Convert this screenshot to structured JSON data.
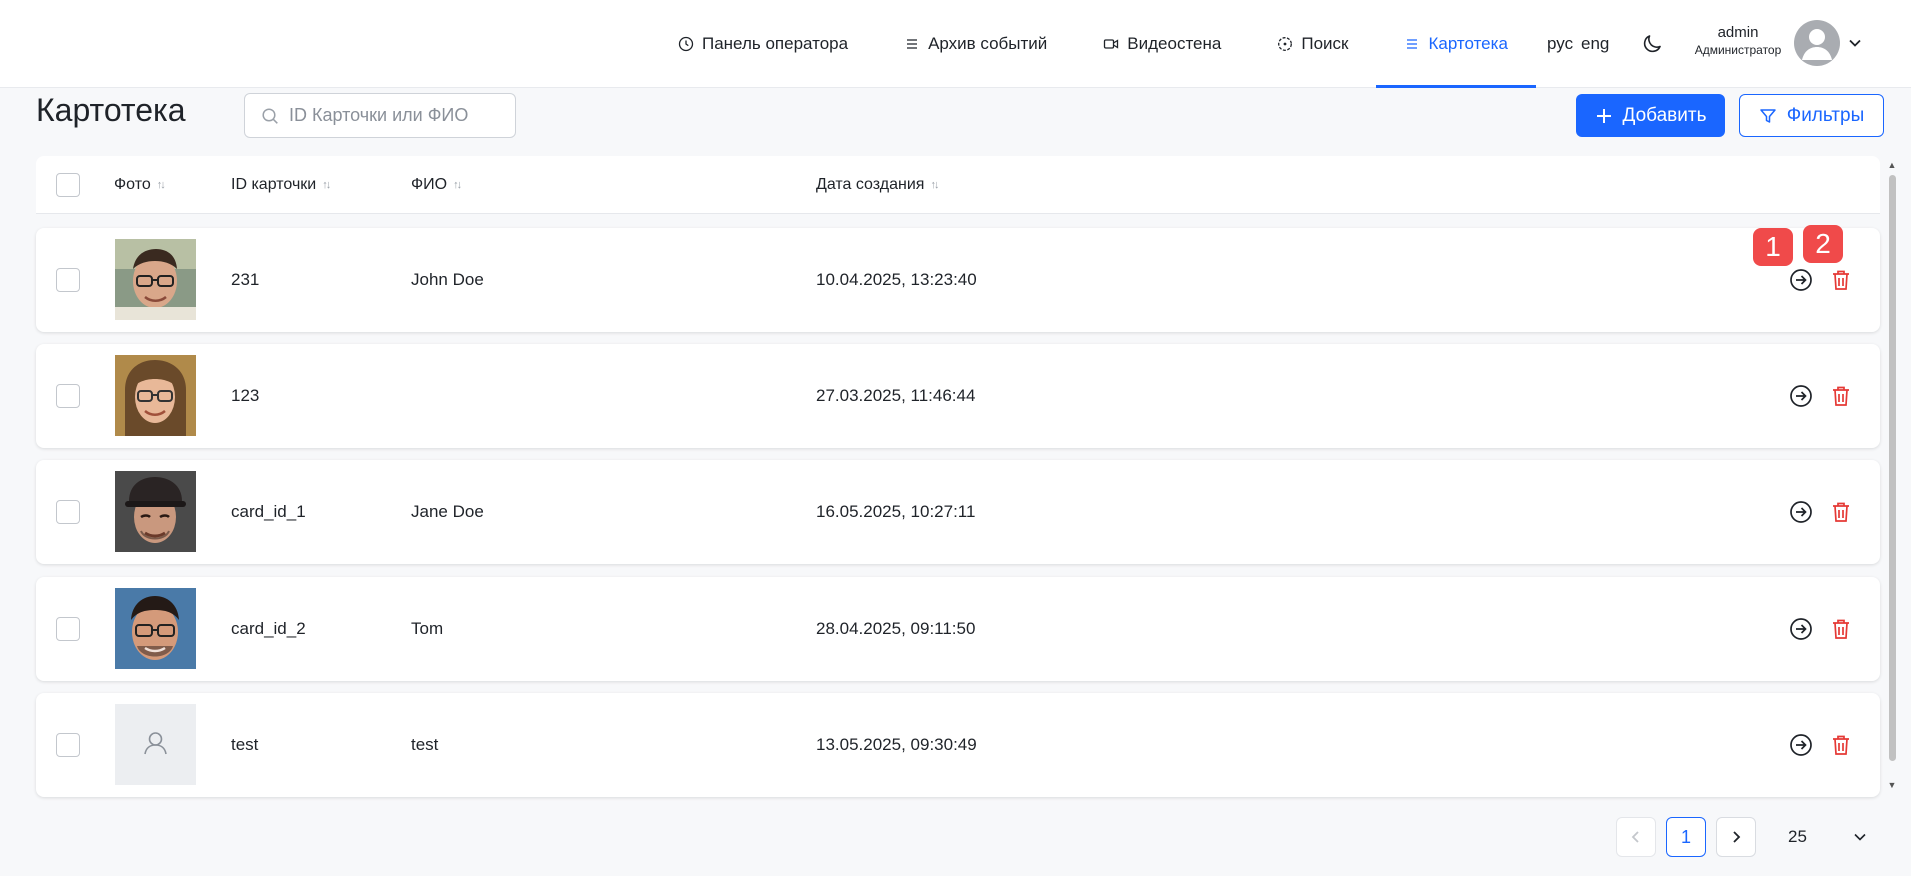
{
  "nav": {
    "items": [
      {
        "label": "Панель оператора",
        "icon": "clock-icon"
      },
      {
        "label": "Архив событий",
        "icon": "list-icon"
      },
      {
        "label": "Видеостена",
        "icon": "video-icon"
      },
      {
        "label": "Поиск",
        "icon": "target-icon"
      },
      {
        "label": "Картотека",
        "icon": "list-icon",
        "active": true
      }
    ],
    "lang_ru": "рус",
    "lang_en": "eng",
    "user_name": "admin",
    "user_role": "Администратор"
  },
  "page": {
    "title": "Картотека",
    "search_placeholder": "ID Карточки или ФИО",
    "add_label": "Добавить",
    "filter_label": "Фильтры"
  },
  "table": {
    "headers": {
      "photo": "Фото",
      "card_id": "ID карточки",
      "name": "ФИО",
      "created": "Дата создания"
    },
    "rows": [
      {
        "card_id": "231",
        "name": "John Doe",
        "created": "10.04.2025, 13:23:40",
        "photo": "man-glasses"
      },
      {
        "card_id": "123",
        "name": "",
        "created": "27.03.2025, 11:46:44",
        "photo": "woman-glasses"
      },
      {
        "card_id": "card_id_1",
        "name": "Jane Doe",
        "created": "16.05.2025, 10:27:11",
        "photo": "man-cap"
      },
      {
        "card_id": "card_id_2",
        "name": "Tom",
        "created": "28.04.2025, 09:11:50",
        "photo": "man-glasses-2"
      },
      {
        "card_id": "test",
        "name": "test",
        "created": "13.05.2025, 09:30:49",
        "photo": "placeholder"
      }
    ]
  },
  "markers": {
    "first": "1",
    "second": "2"
  },
  "pagination": {
    "current_page": "1",
    "page_size": "25"
  },
  "colors": {
    "accent": "#1a66ff",
    "danger": "#e53935",
    "marker": "#f04a4a"
  }
}
